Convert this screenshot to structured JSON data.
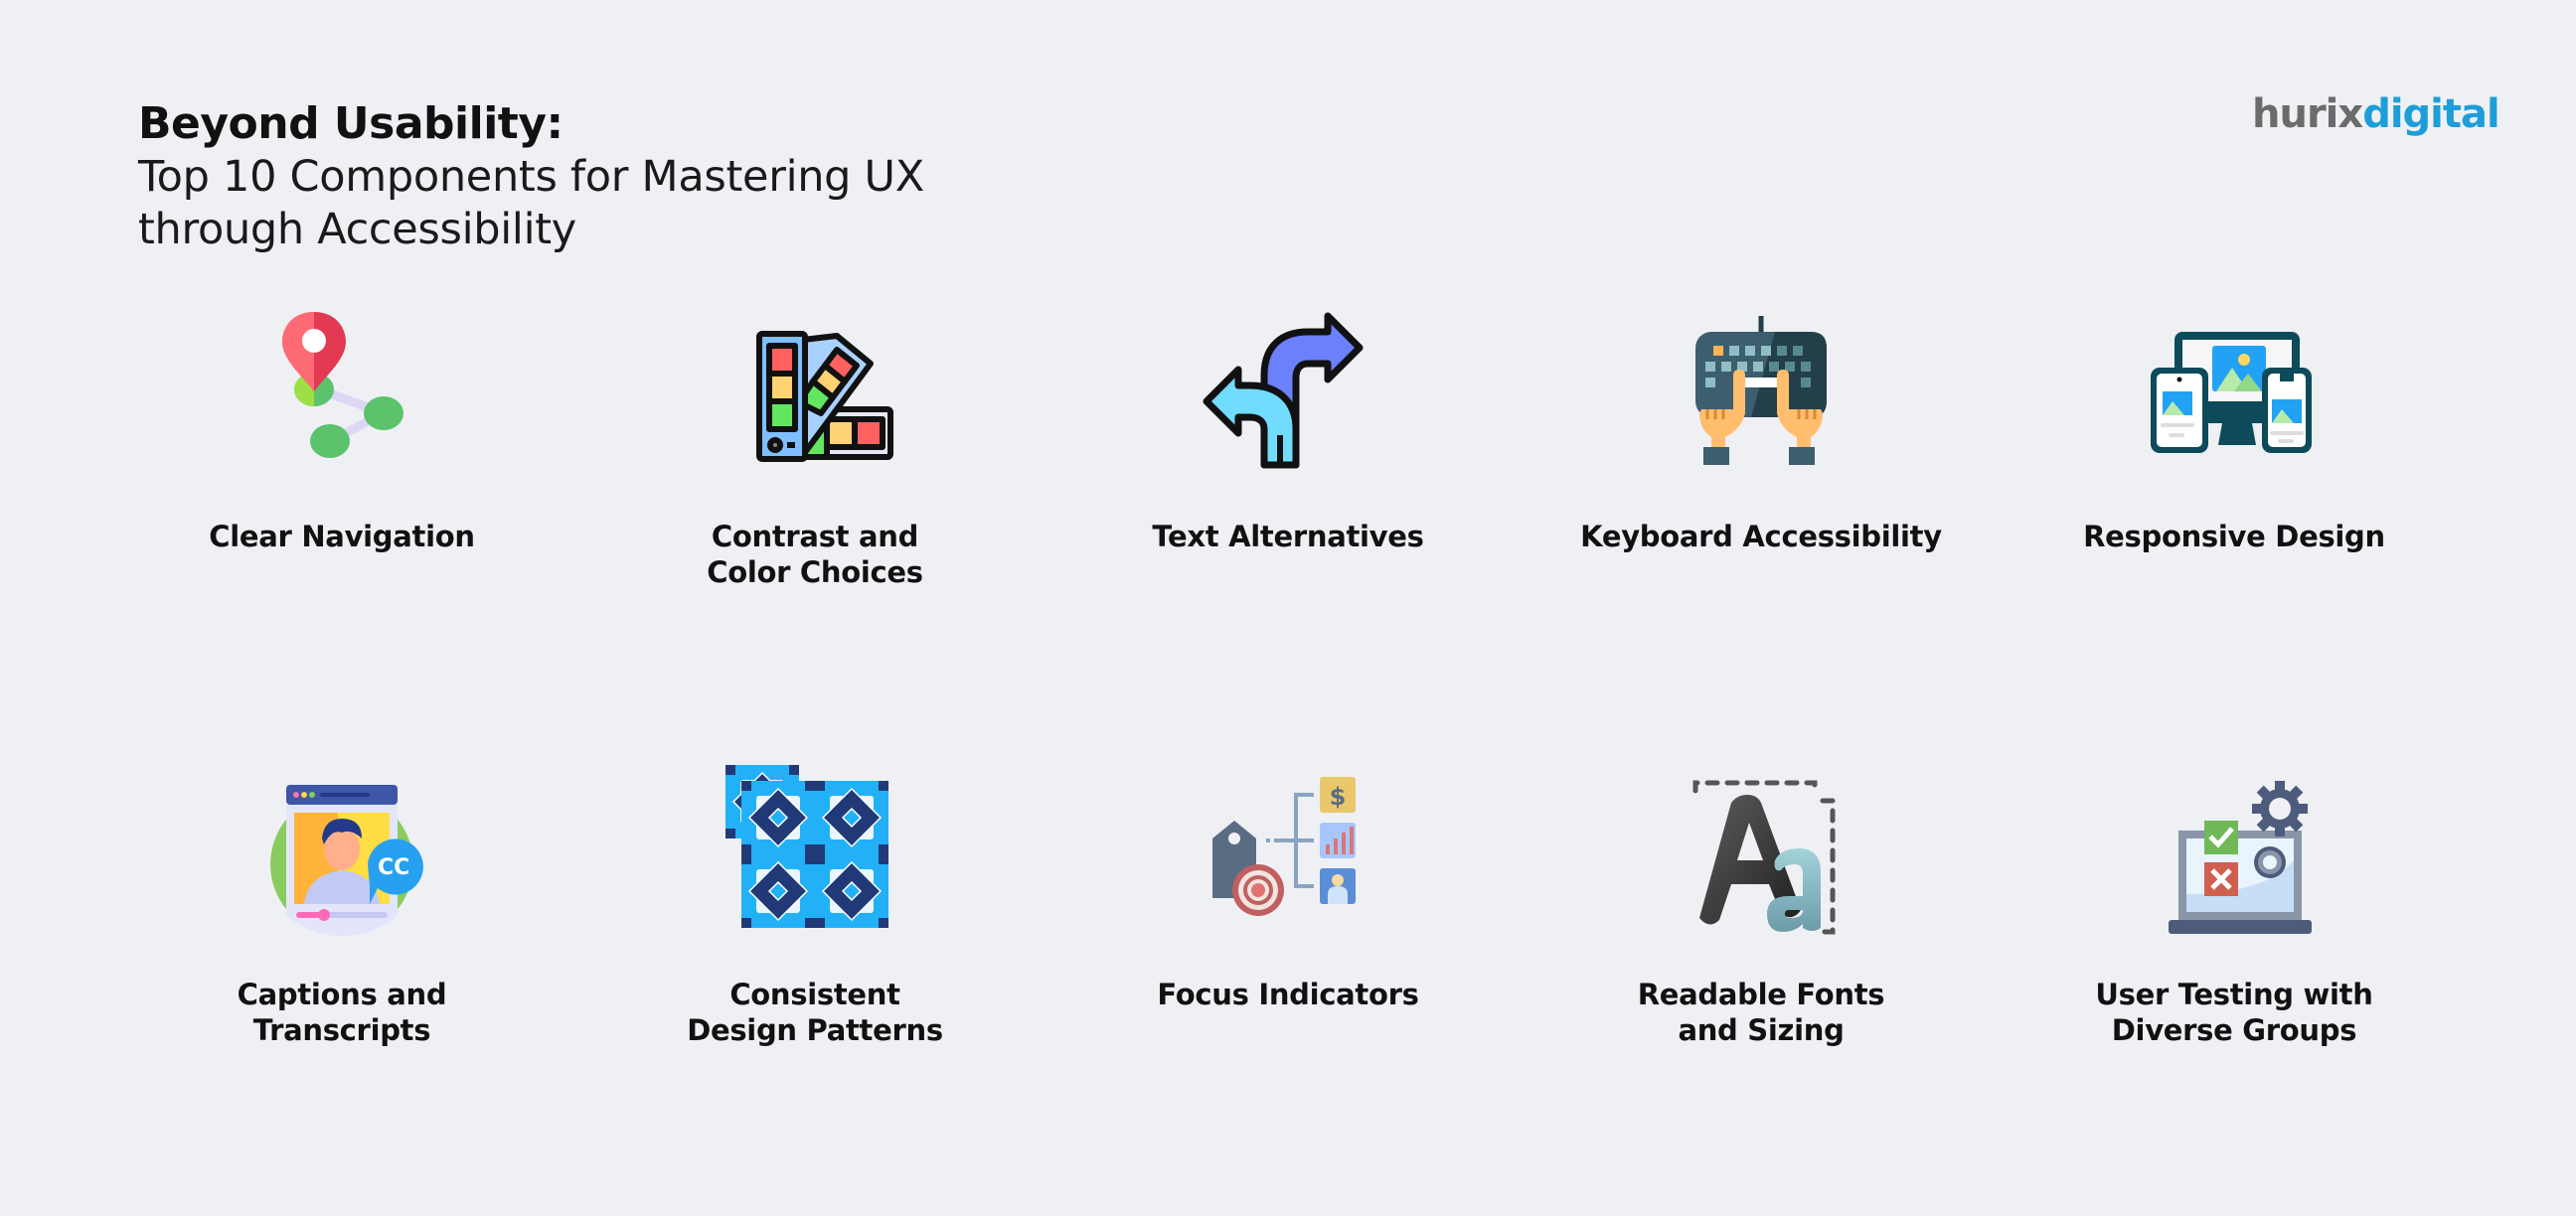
{
  "header": {
    "title_bold": "Beyond Usability:",
    "subtitle_line1": "Top 10 Components for Mastering UX",
    "subtitle_line2": "through Accessibility"
  },
  "logo": {
    "part1": "hurix",
    "part2": "digital",
    "colors": {
      "part1": "#6b6b6b",
      "part2": "#1e9ed8"
    }
  },
  "components": [
    {
      "label": "Clear Navigation",
      "icon": "map-pin-nodes-icon"
    },
    {
      "label": "Contrast and\nColor Choices",
      "icon": "color-swatch-icon"
    },
    {
      "label": "Text Alternatives",
      "icon": "split-arrows-icon"
    },
    {
      "label": "Keyboard Accessibility",
      "icon": "keyboard-hands-icon"
    },
    {
      "label": "Responsive Design",
      "icon": "devices-icon"
    },
    {
      "label": "Captions and\nTranscripts",
      "icon": "video-captions-icon"
    },
    {
      "label": "Consistent\nDesign Patterns",
      "icon": "tile-pattern-icon"
    },
    {
      "label": "Focus Indicators",
      "icon": "target-tag-icon"
    },
    {
      "label": "Readable Fonts\nand Sizing",
      "icon": "font-size-icon"
    },
    {
      "label": "User Testing with\nDiverse Groups",
      "icon": "laptop-testing-icon"
    }
  ],
  "colors": {
    "background": "#eff0f4",
    "text": "#111111"
  }
}
